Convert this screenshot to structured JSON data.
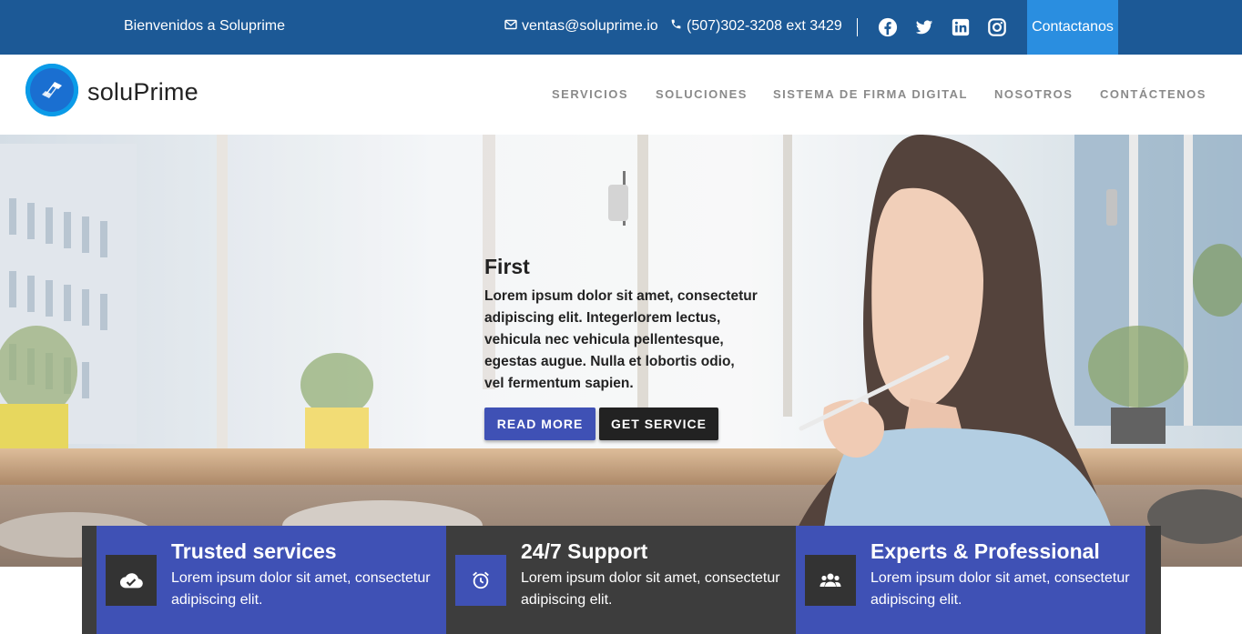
{
  "topbar": {
    "welcome": "Bienvenidos a Soluprime",
    "email": "ventas@soluprime.io",
    "phone": "(507)302-3208 ext 3429",
    "contact_button": "Contactanos",
    "social_icons": [
      "facebook-icon",
      "twitter-icon",
      "linkedin-icon",
      "instagram-icon"
    ]
  },
  "navbar": {
    "logo_text": "soluPrime",
    "items": [
      "SERVICIOS",
      "SOLUCIONES",
      "SISTEMA DE FIRMA DIGITAL",
      "NOSOTROS",
      "CONTÁCTENOS"
    ]
  },
  "hero": {
    "title": "First",
    "text": "Lorem ipsum dolor sit amet, consectetur adipiscing elit. Integerlorem lectus, vehicula nec vehicula pellentesque, egestas augue. Nulla et lobortis odio, vel fermentum sapien.",
    "read_more": "READ MORE",
    "get_service": "GET SERVICE"
  },
  "features": [
    {
      "title": "Trusted services",
      "text": "Lorem ipsum dolor sit amet, consectetur adipiscing elit.",
      "icon": "cloud-check-icon"
    },
    {
      "title": "24/7 Support",
      "text": "Lorem ipsum dolor sit amet, consectetur adipiscing elit.",
      "icon": "alarm-clock-icon"
    },
    {
      "title": "Experts & Professional",
      "text": "Lorem ipsum dolor sit amet, consectetur adipiscing elit.",
      "icon": "people-icon"
    }
  ],
  "colors": {
    "topbar_bg": "#1c5996",
    "contact_button_bg": "#2a8ee0",
    "primary": "#3f51b5",
    "dark": "#222222",
    "feature_strip": "#3d3d3d"
  }
}
